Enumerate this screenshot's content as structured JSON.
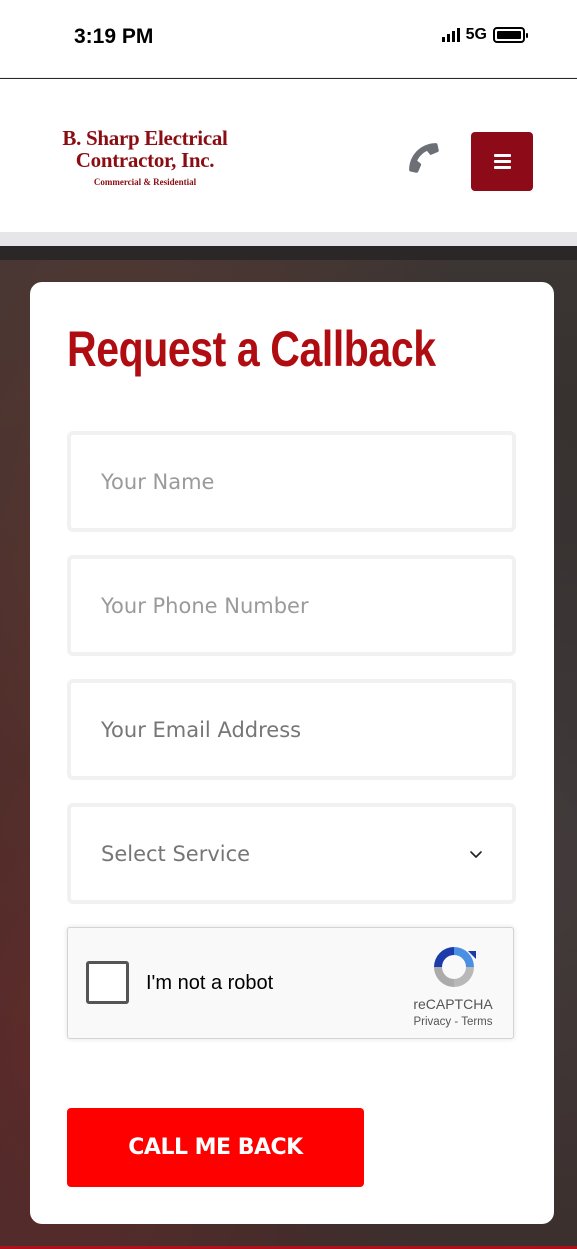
{
  "status_bar": {
    "time": "3:19 PM",
    "network": "5G"
  },
  "header": {
    "logo_line1": "B. Sharp Electrical",
    "logo_line2": "Contractor, Inc.",
    "logo_tagline": "Commercial & Residential",
    "phone_icon": "phone-icon",
    "menu_icon": "hamburger-menu-icon"
  },
  "form": {
    "title": "Request a Callback",
    "name_placeholder": "Your Name",
    "phone_placeholder": "Your Phone Number",
    "email_placeholder": "Your Email Address",
    "service_selected": "Select Service",
    "recaptcha": {
      "label": "I'm not a robot",
      "brand": "reCAPTCHA",
      "privacy": "Privacy",
      "separator": " - ",
      "terms": "Terms"
    },
    "submit_label": "CALL ME BACK"
  },
  "colors": {
    "brand_dark_red": "#8d0b18",
    "title_red": "#b00d12",
    "cta_red": "#fe0000"
  }
}
